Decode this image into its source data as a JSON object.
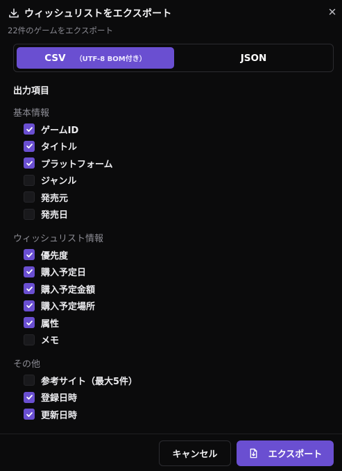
{
  "dialog": {
    "title": "ウィッシュリストをエクスポート",
    "subtitle": "22件のゲームをエクスポート",
    "icons": {
      "download": "download-icon",
      "close": "close-icon",
      "export": "file-export-icon"
    }
  },
  "format": {
    "selected": "csv",
    "csv_label": "CSV",
    "csv_note": "（UTF-8 BOM付き）",
    "json_label": "JSON"
  },
  "fields": {
    "section_title": "出力項目",
    "groups": [
      {
        "label": "基本情報",
        "items": [
          {
            "label": "ゲームID",
            "checked": true
          },
          {
            "label": "タイトル",
            "checked": true
          },
          {
            "label": "プラットフォーム",
            "checked": true
          },
          {
            "label": "ジャンル",
            "checked": false
          },
          {
            "label": "発売元",
            "checked": false
          },
          {
            "label": "発売日",
            "checked": false
          }
        ]
      },
      {
        "label": "ウィッシュリスト情報",
        "items": [
          {
            "label": "優先度",
            "checked": true
          },
          {
            "label": "購入予定日",
            "checked": true
          },
          {
            "label": "購入予定金額",
            "checked": true
          },
          {
            "label": "購入予定場所",
            "checked": true
          },
          {
            "label": "属性",
            "checked": true
          },
          {
            "label": "メモ",
            "checked": false
          }
        ]
      },
      {
        "label": "その他",
        "items": [
          {
            "label": "参考サイト（最大5件）",
            "checked": false
          },
          {
            "label": "登録日時",
            "checked": true
          },
          {
            "label": "更新日時",
            "checked": true
          }
        ]
      }
    ]
  },
  "footer": {
    "cancel_label": "キャンセル",
    "export_label": "エクスポート"
  },
  "colors": {
    "accent": "#6a4fd1",
    "background": "#0b0b0c",
    "muted_text": "#8c8c94"
  }
}
